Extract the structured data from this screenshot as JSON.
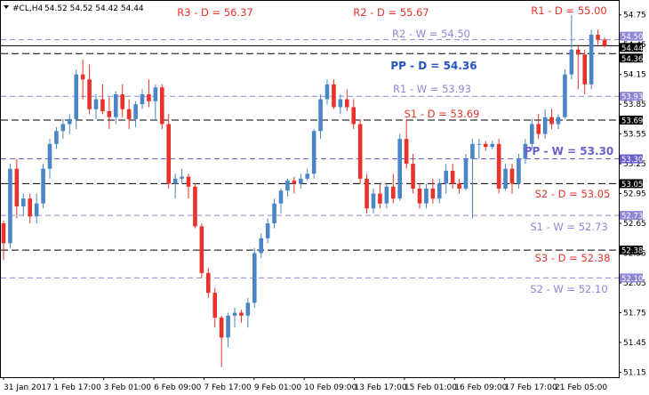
{
  "chart_data": {
    "type": "candlestick",
    "symbol": "#CL,H4",
    "ohlc_header": "54.52 54.52 54.42 54.44",
    "ylim": [
      51.1,
      54.9
    ],
    "y_ticks": [
      "54.75",
      "54.45",
      "54.15",
      "53.85",
      "53.55",
      "53.25",
      "52.95",
      "52.65",
      "52.35",
      "52.05",
      "51.75",
      "51.45",
      "51.15"
    ],
    "x_labels": [
      "31 Jan 2017",
      "1 Feb 17:00",
      "3 Feb 01:00",
      "6 Feb 09:00",
      "7 Feb 17:00",
      "9 Feb 01:00",
      "10 Feb 09:00",
      "13 Feb 17:00",
      "15 Feb 01:00",
      "16 Feb 09:00",
      "17 Feb 17:00",
      "21 Feb 05:00"
    ],
    "levels": [
      {
        "label": "R3 - D = 56.37",
        "value": null,
        "price_tag": "",
        "color": "#e8322a",
        "style": "none",
        "bold": false
      },
      {
        "label": "R2 - D = 55.67",
        "value": null,
        "price_tag": "",
        "color": "#e8322a",
        "style": "none",
        "bold": false
      },
      {
        "label": "R1 - D = 55.00",
        "value": null,
        "price_tag": "",
        "color": "#e8322a",
        "style": "none",
        "bold": false
      },
      {
        "label": "R2 - W = 54.50",
        "value": 54.5,
        "price_tag": "54.50",
        "color": "#8d86d6",
        "style": "dash",
        "bold": false
      },
      {
        "label": "",
        "value": 54.44,
        "price_tag": "54.44",
        "color": "#000000",
        "style": "solid",
        "bold": false
      },
      {
        "label": "PP - D = 54.36",
        "value": 54.36,
        "price_tag": "54.36",
        "color": "#2452c4",
        "style": "dashblack",
        "bold": true
      },
      {
        "label": "R1 - W = 53.93",
        "value": 53.93,
        "price_tag": "53.93",
        "color": "#8d86d6",
        "style": "dash",
        "bold": false
      },
      {
        "label": "S1 - D = 53.69",
        "value": 53.69,
        "price_tag": "53.69",
        "color": "#e8322a",
        "style": "dashblack",
        "bold": false
      },
      {
        "label": "PP - W = 53.30",
        "value": 53.3,
        "price_tag": "53.30",
        "color": "#6a5fcf",
        "style": "dash",
        "bold": true
      },
      {
        "label": "S2 - D = 53.05",
        "value": 53.05,
        "price_tag": "53.05",
        "color": "#e8322a",
        "style": "dashblack",
        "bold": false
      },
      {
        "label": "S1 - W = 52.73",
        "value": 52.73,
        "price_tag": "52.73",
        "color": "#8d86d6",
        "style": "dash",
        "bold": false
      },
      {
        "label": "S3 - D = 52.38",
        "value": 52.38,
        "price_tag": "52.38",
        "color": "#e8322a",
        "style": "dashblack",
        "bold": false
      },
      {
        "label": "S2 - W = 52.10",
        "value": 52.1,
        "price_tag": "52.10",
        "color": "#8d86d6",
        "style": "dash",
        "bold": false
      }
    ],
    "colors": {
      "up": "#4a86c6",
      "down": "#e8322a"
    },
    "candles": [
      [
        52.65,
        52.68,
        52.28,
        52.45
      ],
      [
        52.45,
        53.25,
        52.4,
        53.2
      ],
      [
        53.2,
        53.3,
        52.7,
        52.82
      ],
      [
        52.82,
        52.95,
        52.72,
        52.9
      ],
      [
        52.9,
        52.95,
        52.65,
        52.72
      ],
      [
        52.72,
        52.95,
        52.65,
        52.85
      ],
      [
        52.85,
        53.25,
        52.8,
        53.2
      ],
      [
        53.2,
        53.5,
        53.1,
        53.45
      ],
      [
        53.45,
        53.62,
        53.4,
        53.58
      ],
      [
        53.58,
        53.7,
        53.5,
        53.65
      ],
      [
        53.65,
        53.75,
        53.55,
        53.7
      ],
      [
        53.7,
        54.2,
        53.6,
        54.15
      ],
      [
        54.15,
        54.3,
        53.9,
        54.1
      ],
      [
        54.1,
        54.25,
        53.75,
        53.8
      ],
      [
        53.8,
        53.95,
        53.7,
        53.9
      ],
      [
        53.9,
        54.05,
        53.75,
        53.78
      ],
      [
        53.78,
        53.92,
        53.6,
        53.72
      ],
      [
        53.72,
        53.98,
        53.65,
        53.95
      ],
      [
        53.95,
        54.05,
        53.72,
        53.8
      ],
      [
        53.8,
        53.9,
        53.6,
        53.7
      ],
      [
        53.7,
        53.88,
        53.62,
        53.85
      ],
      [
        53.85,
        54.0,
        53.8,
        53.95
      ],
      [
        53.95,
        54.1,
        53.82,
        53.88
      ],
      [
        53.88,
        54.05,
        53.7,
        54.02
      ],
      [
        54.02,
        54.05,
        53.6,
        53.65
      ],
      [
        53.65,
        53.75,
        53.0,
        53.05
      ],
      [
        53.05,
        53.15,
        52.9,
        53.1
      ],
      [
        53.1,
        53.2,
        53.05,
        53.12
      ],
      [
        53.12,
        53.15,
        52.9,
        53.02
      ],
      [
        53.02,
        53.05,
        52.6,
        52.62
      ],
      [
        52.62,
        52.65,
        52.1,
        52.15
      ],
      [
        52.15,
        52.2,
        51.9,
        51.95
      ],
      [
        51.95,
        52.0,
        51.6,
        51.7
      ],
      [
        51.7,
        51.72,
        51.2,
        51.5
      ],
      [
        51.5,
        51.75,
        51.4,
        51.72
      ],
      [
        51.72,
        51.8,
        51.6,
        51.75
      ],
      [
        51.75,
        51.78,
        51.65,
        51.72
      ],
      [
        51.72,
        51.9,
        51.6,
        51.85
      ],
      [
        51.85,
        52.4,
        51.8,
        52.35
      ],
      [
        52.35,
        52.55,
        52.3,
        52.5
      ],
      [
        52.5,
        52.7,
        52.45,
        52.65
      ],
      [
        52.65,
        52.9,
        52.6,
        52.85
      ],
      [
        52.85,
        53.0,
        52.75,
        52.98
      ],
      [
        52.98,
        53.1,
        52.92,
        53.08
      ],
      [
        53.08,
        53.12,
        52.95,
        53.05
      ],
      [
        53.05,
        53.15,
        53.0,
        53.1
      ],
      [
        53.1,
        53.2,
        53.08,
        53.15
      ],
      [
        53.15,
        53.6,
        53.1,
        53.58
      ],
      [
        53.58,
        53.95,
        53.5,
        53.9
      ],
      [
        53.9,
        54.1,
        53.85,
        54.05
      ],
      [
        54.05,
        54.1,
        53.8,
        53.82
      ],
      [
        53.82,
        53.95,
        53.75,
        53.9
      ],
      [
        53.9,
        54.0,
        53.78,
        53.82
      ],
      [
        53.82,
        53.9,
        53.6,
        53.65
      ],
      [
        53.65,
        53.7,
        53.05,
        53.1
      ],
      [
        53.1,
        53.15,
        52.75,
        52.8
      ],
      [
        52.8,
        53.0,
        52.75,
        52.95
      ],
      [
        52.95,
        53.05,
        52.8,
        52.85
      ],
      [
        52.85,
        53.05,
        52.8,
        53.02
      ],
      [
        53.02,
        53.15,
        52.85,
        52.9
      ],
      [
        52.9,
        53.55,
        52.88,
        53.5
      ],
      [
        53.5,
        53.7,
        53.2,
        53.25
      ],
      [
        53.25,
        53.35,
        52.95,
        53.0
      ],
      [
        53.0,
        53.05,
        52.8,
        52.85
      ],
      [
        52.85,
        53.05,
        52.8,
        53.0
      ],
      [
        53.0,
        53.1,
        52.85,
        52.9
      ],
      [
        52.9,
        53.1,
        52.85,
        53.05
      ],
      [
        53.05,
        53.25,
        52.95,
        53.18
      ],
      [
        53.18,
        53.25,
        53.0,
        53.05
      ],
      [
        53.05,
        53.1,
        52.95,
        53.0
      ],
      [
        53.0,
        53.35,
        52.98,
        53.3
      ],
      [
        53.3,
        53.5,
        52.7,
        53.45
      ],
      [
        53.45,
        53.5,
        53.3,
        53.45
      ],
      [
        53.45,
        53.48,
        53.38,
        53.42
      ],
      [
        53.42,
        53.48,
        53.4,
        53.45
      ],
      [
        53.45,
        53.5,
        52.95,
        53.0
      ],
      [
        53.0,
        53.25,
        52.98,
        53.2
      ],
      [
        53.2,
        53.25,
        52.95,
        53.05
      ],
      [
        53.05,
        53.35,
        53.0,
        53.3
      ],
      [
        53.3,
        53.5,
        53.25,
        53.45
      ],
      [
        53.45,
        53.7,
        53.4,
        53.65
      ],
      [
        53.65,
        53.75,
        53.5,
        53.55
      ],
      [
        53.55,
        53.8,
        53.5,
        53.72
      ],
      [
        53.72,
        53.8,
        53.6,
        53.65
      ],
      [
        53.65,
        53.75,
        53.6,
        53.72
      ],
      [
        53.72,
        54.2,
        53.7,
        54.15
      ],
      [
        54.15,
        54.75,
        54.1,
        54.4
      ],
      [
        54.4,
        54.45,
        54.0,
        54.35
      ],
      [
        54.35,
        54.4,
        53.95,
        54.05
      ],
      [
        54.05,
        54.6,
        54.0,
        54.55
      ],
      [
        54.55,
        54.6,
        54.45,
        54.5
      ],
      [
        54.5,
        54.52,
        54.42,
        54.44
      ]
    ]
  }
}
